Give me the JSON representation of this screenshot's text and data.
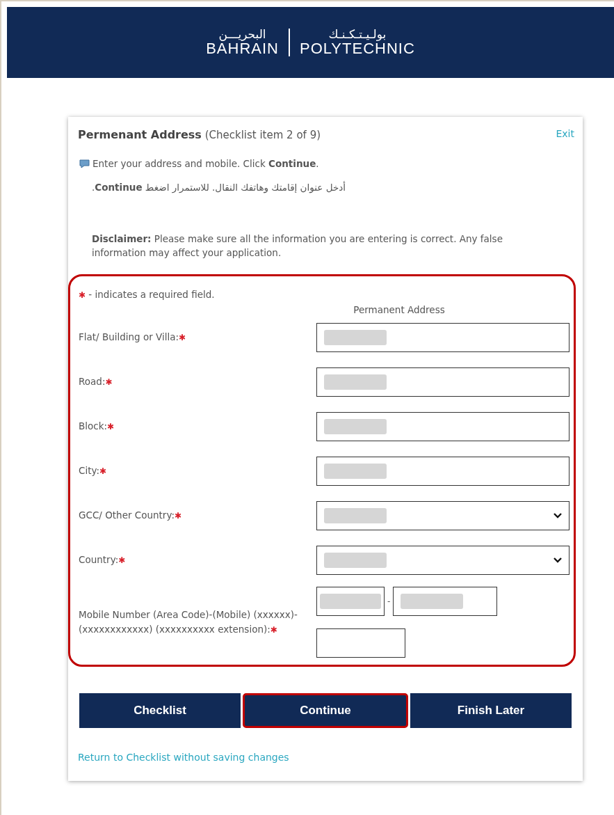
{
  "header": {
    "logo_arabic_left": "البحريـــن",
    "logo_english_left": "BAHRAIN",
    "logo_arabic_right": "بولـيـتـكـنـك",
    "logo_english_right": "POLYTECHNIC"
  },
  "card": {
    "title": "Permenant Address",
    "subtitle": "(Checklist item 2 of 9)",
    "exit_link": "Exit",
    "instruction": "Enter your address and mobile. Click **Continue**.",
    "instruction_arabic": "أدخل عنوان إقامتك وهاتفك النقال. للاستمرار اضغط **Continue**.",
    "disclaimer": "**Disclaimer:** Please make sure all the information you are entering is correct. Any false information may affect your application."
  },
  "form": {
    "highlighted": true,
    "legend_mark": "✱",
    "legend_text": "- indicates a required field.",
    "section_title": "Permanent Address",
    "fields": [
      {
        "kind": "text",
        "label": "Flat/ Building or Villa:",
        "required_mark": "✱",
        "redacted": true
      },
      {
        "kind": "text",
        "label": "Road:",
        "required_mark": "✱",
        "redacted": true
      },
      {
        "kind": "text",
        "label": "Block:",
        "required_mark": "✱",
        "redacted": true
      },
      {
        "kind": "text",
        "label": "City:",
        "required_mark": "✱",
        "redacted": true
      },
      {
        "kind": "select",
        "label": "GCC/ Other Country:",
        "required_mark": "✱",
        "redacted": true
      },
      {
        "kind": "select",
        "label": "Country:",
        "required_mark": "✱",
        "redacted": true
      },
      {
        "kind": "phone",
        "label": "Mobile Number (Area Code)-(Mobile) (xxxxxx)-(xxxxxxxxxxxx) (xxxxxxxxxx extension):",
        "required_mark": "✱",
        "separator": "-",
        "area_redacted": true,
        "mobile_redacted": true,
        "extension_redacted": false
      }
    ]
  },
  "buttons": [
    {
      "label": "Checklist",
      "highlighted": false
    },
    {
      "label": "Continue",
      "highlighted": true
    },
    {
      "label": "Finish Later",
      "highlighted": false
    }
  ],
  "return_link": "Return to Checklist without saving changes"
}
